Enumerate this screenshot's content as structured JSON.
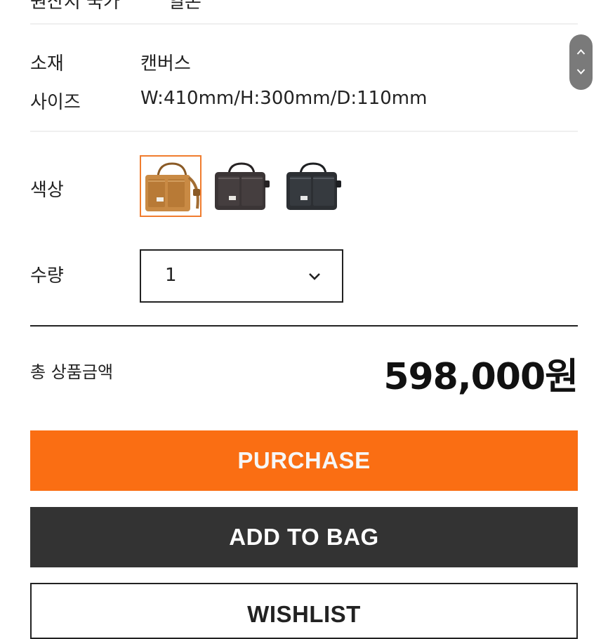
{
  "cut_off_row": {
    "label": "원산지 국가",
    "value": "일본"
  },
  "material": {
    "label": "소재",
    "value": "캔버스"
  },
  "size": {
    "label": "사이즈",
    "value": "W:410mm/H:300mm/D:110mm"
  },
  "color": {
    "label": "색상",
    "options": [
      {
        "name": "tan",
        "hex": "#c98a44",
        "selected": true
      },
      {
        "name": "dark-brown",
        "hex": "#3b3536",
        "selected": false
      },
      {
        "name": "black",
        "hex": "#2c2f33",
        "selected": false
      }
    ]
  },
  "quantity": {
    "label": "수량",
    "value": "1"
  },
  "total": {
    "label": "총 상품금액",
    "price": "598,000원"
  },
  "buttons": {
    "purchase": "PURCHASE",
    "add_to_bag": "ADD TO BAG",
    "wishlist": "WISHLIST"
  },
  "colors": {
    "accent": "#fa6e13",
    "dark_button": "#333333",
    "selected_border": "#f07c2e"
  },
  "icons": {
    "scroll_up": "chevron-up-icon",
    "scroll_down": "chevron-down-icon",
    "select_arrow": "chevron-down-icon"
  }
}
